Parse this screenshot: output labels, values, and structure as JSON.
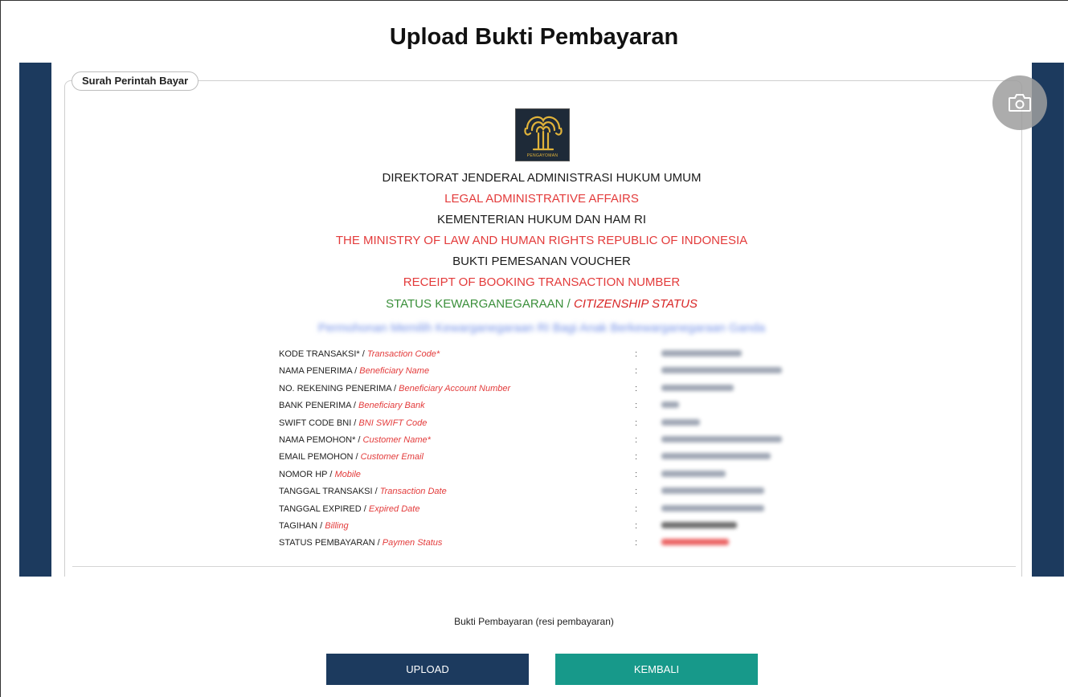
{
  "page": {
    "title": "Upload Bukti Pembayaran"
  },
  "panel": {
    "legend": "Surah Perintah Bayar"
  },
  "logo": {
    "caption": "PENGAYOMAN",
    "icon": "pengayoman-banyan-tree-icon",
    "bg_color": "#1e2a38",
    "accent_color": "#e0b33a"
  },
  "header_lines": [
    {
      "text": "DIREKTORAT JENDERAL ADMINISTRASI HUKUM UMUM",
      "color": "black"
    },
    {
      "text": "LEGAL ADMINISTRATIVE AFFAIRS",
      "color": "red"
    },
    {
      "text": "KEMENTERIAN HUKUM DAN HAM RI",
      "color": "black"
    },
    {
      "text": "THE MINISTRY OF LAW AND HUMAN RIGHTS REPUBLIC OF INDONESIA",
      "color": "red"
    },
    {
      "text": "BUKTI PEMESANAN VOUCHER",
      "color": "black"
    },
    {
      "text": "RECEIPT OF BOOKING TRANSACTION NUMBER",
      "color": "red"
    }
  ],
  "status_line": {
    "id": "STATUS KEWARGANEGARAAN /",
    "en": "CITIZENSHIP STATUS"
  },
  "blurred_service": "Permohonan Memilih Kewarganegaraan RI Bagi Anak Berkewarganegaraan Ganda",
  "info_rows": [
    {
      "label_id": "KODE TRANSAKSI* /",
      "label_en": "Transaction Code*",
      "colon": ":"
    },
    {
      "label_id": "NAMA PENERIMA /",
      "label_en": "Beneficiary Name",
      "colon": ":"
    },
    {
      "label_id": "NO. REKENING PENERIMA /",
      "label_en": "Beneficiary Account Number",
      "colon": ":"
    },
    {
      "label_id": "BANK PENERIMA /",
      "label_en": "Beneficiary Bank",
      "colon": ":"
    },
    {
      "label_id": "SWIFT CODE BNI /",
      "label_en": "BNI SWIFT Code",
      "colon": ":"
    },
    {
      "label_id": "NAMA PEMOHON* /",
      "label_en": "Customer Name*",
      "colon": ":"
    },
    {
      "label_id": "EMAIL PEMOHON /",
      "label_en": "Customer Email",
      "colon": ":"
    },
    {
      "label_id": "NOMOR HP /",
      "label_en": "Mobile",
      "colon": ":"
    },
    {
      "label_id": "TANGGAL TRANSAKSI /",
      "label_en": "Transaction Date",
      "colon": ":"
    },
    {
      "label_id": "TANGGAL EXPIRED /",
      "label_en": "Expired Date",
      "colon": ":"
    },
    {
      "label_id": "TAGIHAN /",
      "label_en": "Billing",
      "colon": ":"
    },
    {
      "label_id": "STATUS PEMBAYARAN /",
      "label_en": "Paymen Status",
      "colon": ":"
    }
  ],
  "camera": {
    "icon": "camera-icon"
  },
  "upload_section": {
    "label": "Bukti Pembayaran (resi pembayaran)",
    "upload_button": "UPLOAD",
    "back_button": "KEMBALI"
  },
  "colors": {
    "navy": "#1c3a5e",
    "teal": "#17998a",
    "red_text": "#e33b3b",
    "green_text": "#3a8f3a"
  }
}
